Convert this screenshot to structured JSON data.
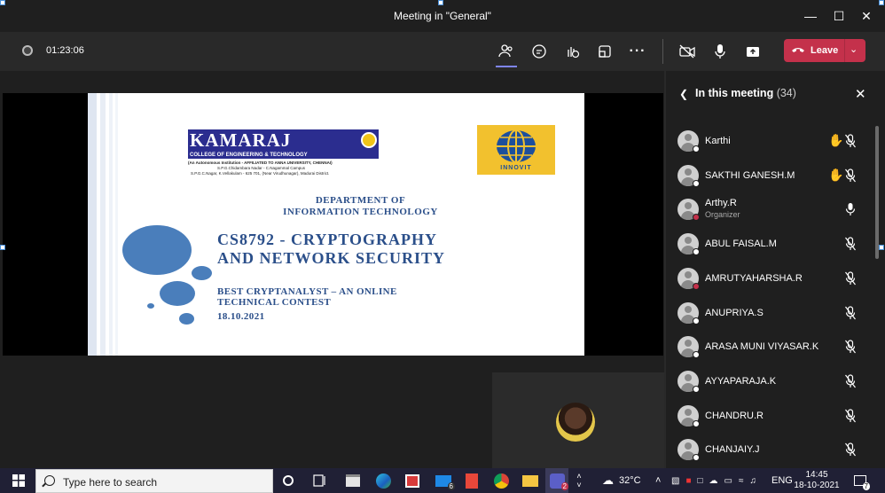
{
  "window": {
    "title": "Meeting in \"General\""
  },
  "toolbar": {
    "timer": "01:23:06",
    "leave_label": "Leave"
  },
  "slide": {
    "college_name": "KAMARAJ",
    "college_sub": "COLLEGE OF ENGINEERING & TECHNOLOGY",
    "college_line1": "(An Autonomous Institution - AFFILIATED TO ANNA UNIVERSITY, CHENNAI)",
    "college_line2": "S.P.G.Chidambara Nadar - C.Nagammal Campus",
    "college_line3": "S.P.G.C.Nagar, K.Vellakulam - 625 701, (Near Virudhunagar), Madurai District.",
    "partner_logo_text": "INNOVIT",
    "department_line1": "DEPARTMENT OF",
    "department_line2": "INFORMATION TECHNOLOGY",
    "course_line1": "CS8792 - CRYPTOGRAPHY",
    "course_line2": "AND NETWORK SECURITY",
    "contest_line1": "BEST CRYPTANALYST – AN ONLINE",
    "contest_line2": "TECHNICAL CONTEST",
    "date": "18.10.2021"
  },
  "panel": {
    "title": "In this meeting",
    "count": "(34)",
    "participants": [
      {
        "name": "Karthi",
        "role": "",
        "hand_raised": true,
        "mic": "muted",
        "presence": "available"
      },
      {
        "name": "SAKTHI GANESH.M",
        "role": "",
        "hand_raised": true,
        "mic": "muted",
        "presence": "available"
      },
      {
        "name": "Arthy.R",
        "role": "Organizer",
        "hand_raised": false,
        "mic": "on",
        "presence": "busy"
      },
      {
        "name": "ABUL FAISAL.M",
        "role": "",
        "hand_raised": false,
        "mic": "muted",
        "presence": "available"
      },
      {
        "name": "AMRUTYAHARSHA.R",
        "role": "",
        "hand_raised": false,
        "mic": "muted",
        "presence": "busy"
      },
      {
        "name": "ANUPRIYA.S",
        "role": "",
        "hand_raised": false,
        "mic": "muted",
        "presence": "available"
      },
      {
        "name": "ARASA MUNI VIYASAR.K",
        "role": "",
        "hand_raised": false,
        "mic": "muted",
        "presence": "available"
      },
      {
        "name": "AYYAPARAJA.K",
        "role": "",
        "hand_raised": false,
        "mic": "muted",
        "presence": "available"
      },
      {
        "name": "CHANDRU.R",
        "role": "",
        "hand_raised": false,
        "mic": "muted",
        "presence": "available"
      },
      {
        "name": "CHANJAIY.J",
        "role": "",
        "hand_raised": false,
        "mic": "muted",
        "presence": "available"
      }
    ]
  },
  "taskbar": {
    "search_placeholder": "Type here to search",
    "weather": "32°C",
    "language": "ENG",
    "time": "14:45",
    "date": "18-10-2021",
    "mail_badge": "6",
    "teams_badge": "2",
    "notif_badge": "7"
  },
  "colors": {
    "accent": "#7f85f5",
    "leave": "#c4314b",
    "slide_blue": "#2b4f8a",
    "hand": "#f4b400"
  }
}
